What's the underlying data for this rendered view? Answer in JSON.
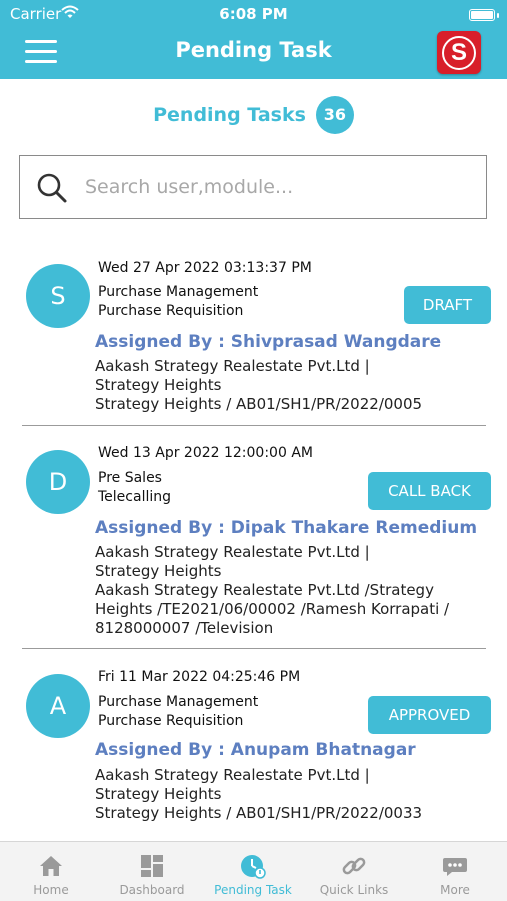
{
  "status_bar": {
    "carrier": "Carrier",
    "time": "6:08 PM"
  },
  "header": {
    "title": "Pending Task",
    "logo_letter": "S"
  },
  "summary": {
    "label": "Pending Tasks",
    "count": "36"
  },
  "search": {
    "placeholder": "Search user,module..."
  },
  "tasks": [
    {
      "avatar": "S",
      "datetime": "Wed 27 Apr 2022 03:13:37 PM",
      "module": "Purchase Management",
      "submodule": "Purchase Requisition",
      "status": "DRAFT",
      "assigned_by": "Assigned By : Shivprasad Wangdare",
      "details": [
        "Aakash Strategy Realestate Pvt.Ltd |",
        "Strategy Heights",
        "Strategy Heights / AB01/SH1/PR/2022/0005"
      ]
    },
    {
      "avatar": "D",
      "datetime": "Wed 13 Apr 2022 12:00:00 AM",
      "module": "Pre Sales",
      "submodule": "Telecalling",
      "status": "CALL BACK",
      "assigned_by": "Assigned By : Dipak Thakare Remedium",
      "details": [
        "Aakash Strategy Realestate Pvt.Ltd |",
        "Strategy Heights",
        "Aakash Strategy Realestate Pvt.Ltd /Strategy",
        "Heights /TE2021/06/00002 /Ramesh Korrapati /",
        "8128000007 /Television"
      ]
    },
    {
      "avatar": "A",
      "datetime": "Fri 11 Mar 2022 04:25:46 PM",
      "module": "Purchase Management",
      "submodule": "Purchase Requisition",
      "status": "APPROVED",
      "assigned_by": "Assigned By : Anupam Bhatnagar",
      "details": [
        "Aakash Strategy Realestate Pvt.Ltd |",
        "Strategy Heights",
        "Strategy Heights / AB01/SH1/PR/2022/0033"
      ]
    }
  ],
  "tabs": [
    {
      "label": "Home",
      "icon": "home-icon"
    },
    {
      "label": "Dashboard",
      "icon": "dashboard-icon"
    },
    {
      "label": "Pending Task",
      "icon": "pending-task-icon",
      "active": true
    },
    {
      "label": "Quick Links",
      "icon": "link-icon"
    },
    {
      "label": "More",
      "icon": "more-icon"
    }
  ],
  "colors": {
    "accent": "#41bcd6",
    "assigned": "#5d7fc0",
    "logo": "#d81f2a",
    "tab_inactive": "#9a9a9a"
  }
}
